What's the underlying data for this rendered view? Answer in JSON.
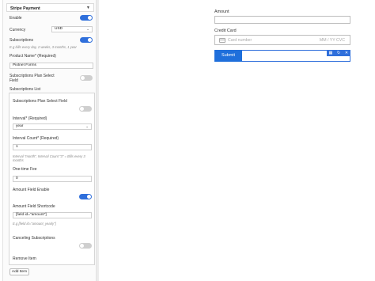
{
  "settings_panel": {
    "title": "Stripe Payment",
    "enable_label": "Enable",
    "enable": true,
    "currency_label": "Currency",
    "currency_value": "USD",
    "subscriptions_label": "Subscriptions",
    "subscriptions": true,
    "subscriptions_help": "E.g bills every day, 2 weeks, 3 months, 1 year",
    "product_name_label": "Product Name* (Required)",
    "product_name_value": "Piotnet Forms",
    "plan_select_field_label_line1": "Subscriptions Plan Select",
    "plan_select_field_label_line2": "Field",
    "plan_select_field": false,
    "subscriptions_list_label": "Subscriptions List",
    "add_item_label": "Add Item"
  },
  "subscription_item": {
    "plan_select_field_label": "Subscriptions Plan Select Field",
    "plan_select_field": false,
    "interval_label": "Interval* (Required)",
    "interval_value": "year",
    "interval_count_label": "Interval Count* (Required)",
    "interval_count_value": "1",
    "interval_count_help_line1": "Interval \"month\", Interval Count \"3\" = Bills every 3",
    "interval_count_help_line2": "months",
    "one_time_fee_label": "One-time Fee",
    "one_time_fee_value": "0",
    "amount_field_enable_label": "Amount Field Enable",
    "amount_field_enable": true,
    "amount_field_shortcode_label": "Amount Field Shortcode",
    "amount_field_shortcode_value": "[field id=\"amount\"]",
    "amount_field_shortcode_help": "E.g [field id=\"amount_yearly\"]",
    "canceling_label": "Canceling Subscriptions",
    "canceling": false,
    "remove_label": "Remove Item"
  },
  "form_preview": {
    "amount_label": "Amount",
    "credit_card_label": "Credit Card",
    "card_number_placeholder": "Card number",
    "mm_yy_cvc_placeholder": "MM / YY  CVC",
    "submit_label": "Submit",
    "toolbar_icons": [
      "grid-icon",
      "refresh-icon",
      "close-icon"
    ]
  },
  "colors": {
    "accent": "#2f6fdb",
    "submit": "#1f6fdb",
    "toggle_off": "#cfcfcf"
  }
}
